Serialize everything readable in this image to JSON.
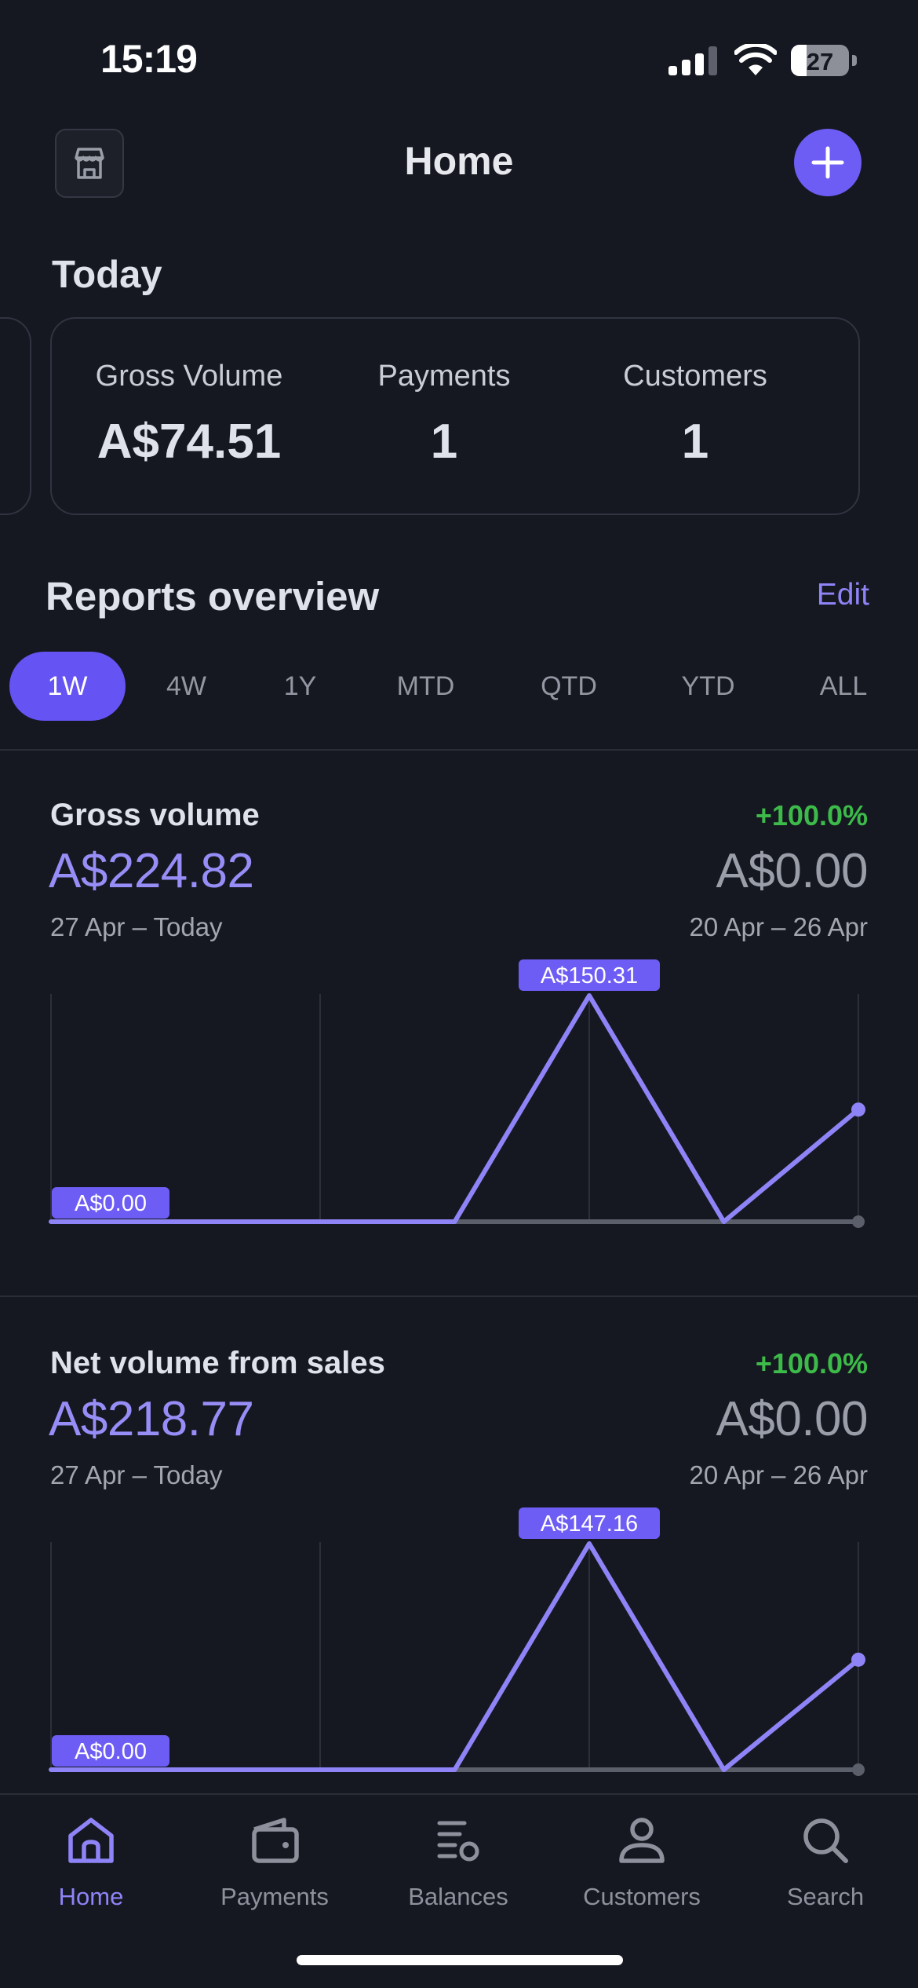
{
  "status_bar": {
    "time": "15:19",
    "battery": "27"
  },
  "header": {
    "title": "Home"
  },
  "today": {
    "title": "Today",
    "metrics": [
      {
        "label": "Gross Volume",
        "value": "A$74.51"
      },
      {
        "label": "Payments",
        "value": "1"
      },
      {
        "label": "Customers",
        "value": "1"
      }
    ]
  },
  "reports": {
    "title": "Reports overview",
    "edit_label": "Edit",
    "periods": [
      "1W",
      "4W",
      "1Y",
      "MTD",
      "QTD",
      "YTD",
      "ALL"
    ],
    "selected_period": "1W",
    "items": [
      {
        "name": "Gross volume",
        "value": "A$224.82",
        "change": "+100.0%",
        "previous_value": "A$0.00",
        "range": "27 Apr – Today",
        "previous_range": "20 Apr – 26 Apr",
        "start_label": "A$0.00",
        "peak_label": "A$150.31"
      },
      {
        "name": "Net volume from sales",
        "value": "A$218.77",
        "change": "+100.0%",
        "previous_value": "A$0.00",
        "range": "27 Apr – Today",
        "previous_range": "20 Apr – 26 Apr",
        "start_label": "A$0.00",
        "peak_label": "A$147.16"
      }
    ]
  },
  "chart_data": [
    {
      "type": "line",
      "x": [
        0,
        1,
        2,
        3,
        4,
        5,
        6
      ],
      "series": [
        {
          "values": [
            0,
            0,
            0,
            0,
            150.31,
            0,
            74.51
          ],
          "color": "#8e84f7"
        },
        {
          "values": [
            0,
            0,
            0,
            0,
            0,
            0,
            0
          ],
          "color": "#5b5f6a"
        }
      ],
      "ylim": [
        0,
        150.31
      ],
      "grid": true
    },
    {
      "type": "line",
      "x": [
        0,
        1,
        2,
        3,
        4,
        5,
        6
      ],
      "series": [
        {
          "values": [
            0,
            0,
            0,
            0,
            147.16,
            0,
            71.61
          ],
          "color": "#8e84f7"
        },
        {
          "values": [
            0,
            0,
            0,
            0,
            0,
            0,
            0
          ],
          "color": "#5b5f6a"
        }
      ],
      "ylim": [
        0,
        147.16
      ],
      "grid": true
    }
  ],
  "tab_bar": {
    "items": [
      {
        "label": "Home",
        "icon": "home-icon"
      },
      {
        "label": "Payments",
        "icon": "wallet-icon"
      },
      {
        "label": "Balances",
        "icon": "balances-icon"
      },
      {
        "label": "Customers",
        "icon": "user-icon"
      },
      {
        "label": "Search",
        "icon": "search-icon"
      }
    ],
    "active": "Home"
  },
  "colors": {
    "background": "#161821",
    "accent": "#6e5df5",
    "accent_text": "#8e84f7",
    "positive": "#3dbb4a"
  }
}
